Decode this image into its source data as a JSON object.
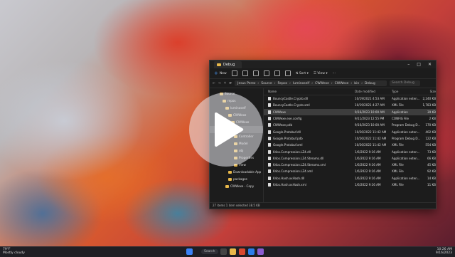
{
  "window": {
    "tab_title": "Debug",
    "new_label": "New",
    "sort_label": "Sort",
    "view_label": "View",
    "breadcrumb": [
      "Jesus Perez",
      "Source",
      "Repos",
      "luminoself",
      "CWWexe",
      "CWWexe",
      "bin",
      "Debug"
    ],
    "search_placeholder": "Search Debug",
    "status_text": "27 items    1 item selected  38.5 KB"
  },
  "nav": {
    "items": [
      {
        "label": "Source",
        "indent": 0
      },
      {
        "label": "repos",
        "indent": 1
      },
      {
        "label": "luminoself",
        "indent": 2
      },
      {
        "label": "CWWexe",
        "indent": 3
      },
      {
        "label": "CWWexe",
        "indent": 4
      },
      {
        "label": "bin",
        "indent": 5,
        "selected": true
      },
      {
        "label": "Controller",
        "indent": 5
      },
      {
        "label": "Model",
        "indent": 5
      },
      {
        "label": "obj",
        "indent": 5
      },
      {
        "label": "Properties",
        "indent": 5
      },
      {
        "label": "View",
        "indent": 5
      },
      {
        "label": "Downloadable App",
        "indent": 3
      },
      {
        "label": "packages",
        "indent": 3
      },
      {
        "label": "CWWexe - Copy",
        "indent": 2
      }
    ]
  },
  "columns": {
    "name": "Name",
    "date": "Date modified",
    "type": "Type",
    "size": "Size"
  },
  "files": [
    {
      "name": "BouncyCastle.Crypto.dll",
      "date": "10/19/2021 4:53 AM",
      "type": "Application exten...",
      "size": "2,240 KB"
    },
    {
      "name": "BouncyCastle.Crypto.xml",
      "date": "10/19/2021 4:27 AM",
      "type": "XML File",
      "size": "1,783 KB"
    },
    {
      "name": "CWWexe",
      "date": "9/16/2023 10:00 AM",
      "type": "Application",
      "size": "39 KB",
      "selected": true
    },
    {
      "name": "CWWexe.exe.config",
      "date": "9/11/2023 12:55 PM",
      "type": "CONFIG File",
      "size": "2 KB"
    },
    {
      "name": "CWWexe.pdb",
      "date": "9/16/2023 10:00 AM",
      "type": "Program Debug D...",
      "size": "170 KB"
    },
    {
      "name": "Google.Protobuf.dll",
      "date": "10/26/2022 11:42 AM",
      "type": "Application exten...",
      "size": "402 KB"
    },
    {
      "name": "Google.Protobuf.pdb",
      "date": "10/26/2022 11:42 AM",
      "type": "Program Debug D...",
      "size": "122 KB"
    },
    {
      "name": "Google.Protobuf.xml",
      "date": "10/26/2022 11:42 AM",
      "type": "XML File",
      "size": "554 KB"
    },
    {
      "name": "K4os.Compression.LZ4.dll",
      "date": "1/6/2022 9:16 AM",
      "type": "Application exten...",
      "size": "73 KB"
    },
    {
      "name": "K4os.Compression.LZ4.Streams.dll",
      "date": "1/6/2022 9:16 AM",
      "type": "Application exten...",
      "size": "66 KB"
    },
    {
      "name": "K4os.Compression.LZ4.Streams.xml",
      "date": "1/6/2022 9:16 AM",
      "type": "XML File",
      "size": "45 KB"
    },
    {
      "name": "K4os.Compression.LZ4.xml",
      "date": "1/6/2022 9:16 AM",
      "type": "XML File",
      "size": "92 KB"
    },
    {
      "name": "K4os.Hash.xxHash.dll",
      "date": "1/6/2022 9:16 AM",
      "type": "Application exten...",
      "size": "14 KB"
    },
    {
      "name": "K4os.Hash.xxHash.xml",
      "date": "1/6/2022 9:16 AM",
      "type": "XML File",
      "size": "11 KB"
    }
  ],
  "taskbar": {
    "weather_temp": "79°F",
    "weather_desc": "Mostly cloudy",
    "search_label": "Search",
    "time": "10:26 AM",
    "date": "9/16/2023"
  }
}
